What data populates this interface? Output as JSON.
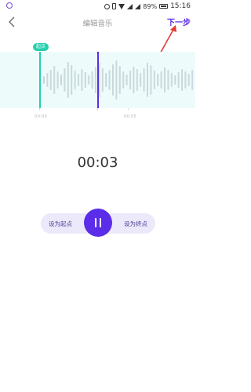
{
  "status_bar": {
    "battery": "89%",
    "time": "15:16"
  },
  "header": {
    "title": "编辑音乐",
    "next_label": "下一步"
  },
  "waveform": {
    "start_marker_label": "起点",
    "ticks": [
      "00:00",
      "00:05"
    ]
  },
  "player": {
    "current_time": "00:03",
    "set_start_label": "设为起点",
    "set_end_label": "设为终点"
  },
  "colors": {
    "accent": "#5b2de8",
    "start_marker": "#24cfae",
    "wave_bg": "#eefbfb",
    "pill_bg": "#ece9fb"
  }
}
